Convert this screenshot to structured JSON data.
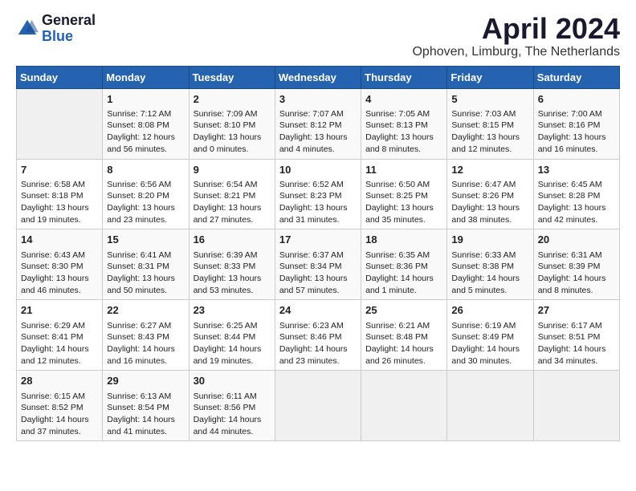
{
  "logo": {
    "text1": "General",
    "text2": "Blue"
  },
  "title": "April 2024",
  "subtitle": "Ophoven, Limburg, The Netherlands",
  "headers": [
    "Sunday",
    "Monday",
    "Tuesday",
    "Wednesday",
    "Thursday",
    "Friday",
    "Saturday"
  ],
  "weeks": [
    [
      {
        "day": "",
        "info": ""
      },
      {
        "day": "1",
        "info": "Sunrise: 7:12 AM\nSunset: 8:08 PM\nDaylight: 12 hours\nand 56 minutes."
      },
      {
        "day": "2",
        "info": "Sunrise: 7:09 AM\nSunset: 8:10 PM\nDaylight: 13 hours\nand 0 minutes."
      },
      {
        "day": "3",
        "info": "Sunrise: 7:07 AM\nSunset: 8:12 PM\nDaylight: 13 hours\nand 4 minutes."
      },
      {
        "day": "4",
        "info": "Sunrise: 7:05 AM\nSunset: 8:13 PM\nDaylight: 13 hours\nand 8 minutes."
      },
      {
        "day": "5",
        "info": "Sunrise: 7:03 AM\nSunset: 8:15 PM\nDaylight: 13 hours\nand 12 minutes."
      },
      {
        "day": "6",
        "info": "Sunrise: 7:00 AM\nSunset: 8:16 PM\nDaylight: 13 hours\nand 16 minutes."
      }
    ],
    [
      {
        "day": "7",
        "info": "Sunrise: 6:58 AM\nSunset: 8:18 PM\nDaylight: 13 hours\nand 19 minutes."
      },
      {
        "day": "8",
        "info": "Sunrise: 6:56 AM\nSunset: 8:20 PM\nDaylight: 13 hours\nand 23 minutes."
      },
      {
        "day": "9",
        "info": "Sunrise: 6:54 AM\nSunset: 8:21 PM\nDaylight: 13 hours\nand 27 minutes."
      },
      {
        "day": "10",
        "info": "Sunrise: 6:52 AM\nSunset: 8:23 PM\nDaylight: 13 hours\nand 31 minutes."
      },
      {
        "day": "11",
        "info": "Sunrise: 6:50 AM\nSunset: 8:25 PM\nDaylight: 13 hours\nand 35 minutes."
      },
      {
        "day": "12",
        "info": "Sunrise: 6:47 AM\nSunset: 8:26 PM\nDaylight: 13 hours\nand 38 minutes."
      },
      {
        "day": "13",
        "info": "Sunrise: 6:45 AM\nSunset: 8:28 PM\nDaylight: 13 hours\nand 42 minutes."
      }
    ],
    [
      {
        "day": "14",
        "info": "Sunrise: 6:43 AM\nSunset: 8:30 PM\nDaylight: 13 hours\nand 46 minutes."
      },
      {
        "day": "15",
        "info": "Sunrise: 6:41 AM\nSunset: 8:31 PM\nDaylight: 13 hours\nand 50 minutes."
      },
      {
        "day": "16",
        "info": "Sunrise: 6:39 AM\nSunset: 8:33 PM\nDaylight: 13 hours\nand 53 minutes."
      },
      {
        "day": "17",
        "info": "Sunrise: 6:37 AM\nSunset: 8:34 PM\nDaylight: 13 hours\nand 57 minutes."
      },
      {
        "day": "18",
        "info": "Sunrise: 6:35 AM\nSunset: 8:36 PM\nDaylight: 14 hours\nand 1 minute."
      },
      {
        "day": "19",
        "info": "Sunrise: 6:33 AM\nSunset: 8:38 PM\nDaylight: 14 hours\nand 5 minutes."
      },
      {
        "day": "20",
        "info": "Sunrise: 6:31 AM\nSunset: 8:39 PM\nDaylight: 14 hours\nand 8 minutes."
      }
    ],
    [
      {
        "day": "21",
        "info": "Sunrise: 6:29 AM\nSunset: 8:41 PM\nDaylight: 14 hours\nand 12 minutes."
      },
      {
        "day": "22",
        "info": "Sunrise: 6:27 AM\nSunset: 8:43 PM\nDaylight: 14 hours\nand 16 minutes."
      },
      {
        "day": "23",
        "info": "Sunrise: 6:25 AM\nSunset: 8:44 PM\nDaylight: 14 hours\nand 19 minutes."
      },
      {
        "day": "24",
        "info": "Sunrise: 6:23 AM\nSunset: 8:46 PM\nDaylight: 14 hours\nand 23 minutes."
      },
      {
        "day": "25",
        "info": "Sunrise: 6:21 AM\nSunset: 8:48 PM\nDaylight: 14 hours\nand 26 minutes."
      },
      {
        "day": "26",
        "info": "Sunrise: 6:19 AM\nSunset: 8:49 PM\nDaylight: 14 hours\nand 30 minutes."
      },
      {
        "day": "27",
        "info": "Sunrise: 6:17 AM\nSunset: 8:51 PM\nDaylight: 14 hours\nand 34 minutes."
      }
    ],
    [
      {
        "day": "28",
        "info": "Sunrise: 6:15 AM\nSunset: 8:52 PM\nDaylight: 14 hours\nand 37 minutes."
      },
      {
        "day": "29",
        "info": "Sunrise: 6:13 AM\nSunset: 8:54 PM\nDaylight: 14 hours\nand 41 minutes."
      },
      {
        "day": "30",
        "info": "Sunrise: 6:11 AM\nSunset: 8:56 PM\nDaylight: 14 hours\nand 44 minutes."
      },
      {
        "day": "",
        "info": ""
      },
      {
        "day": "",
        "info": ""
      },
      {
        "day": "",
        "info": ""
      },
      {
        "day": "",
        "info": ""
      }
    ]
  ]
}
